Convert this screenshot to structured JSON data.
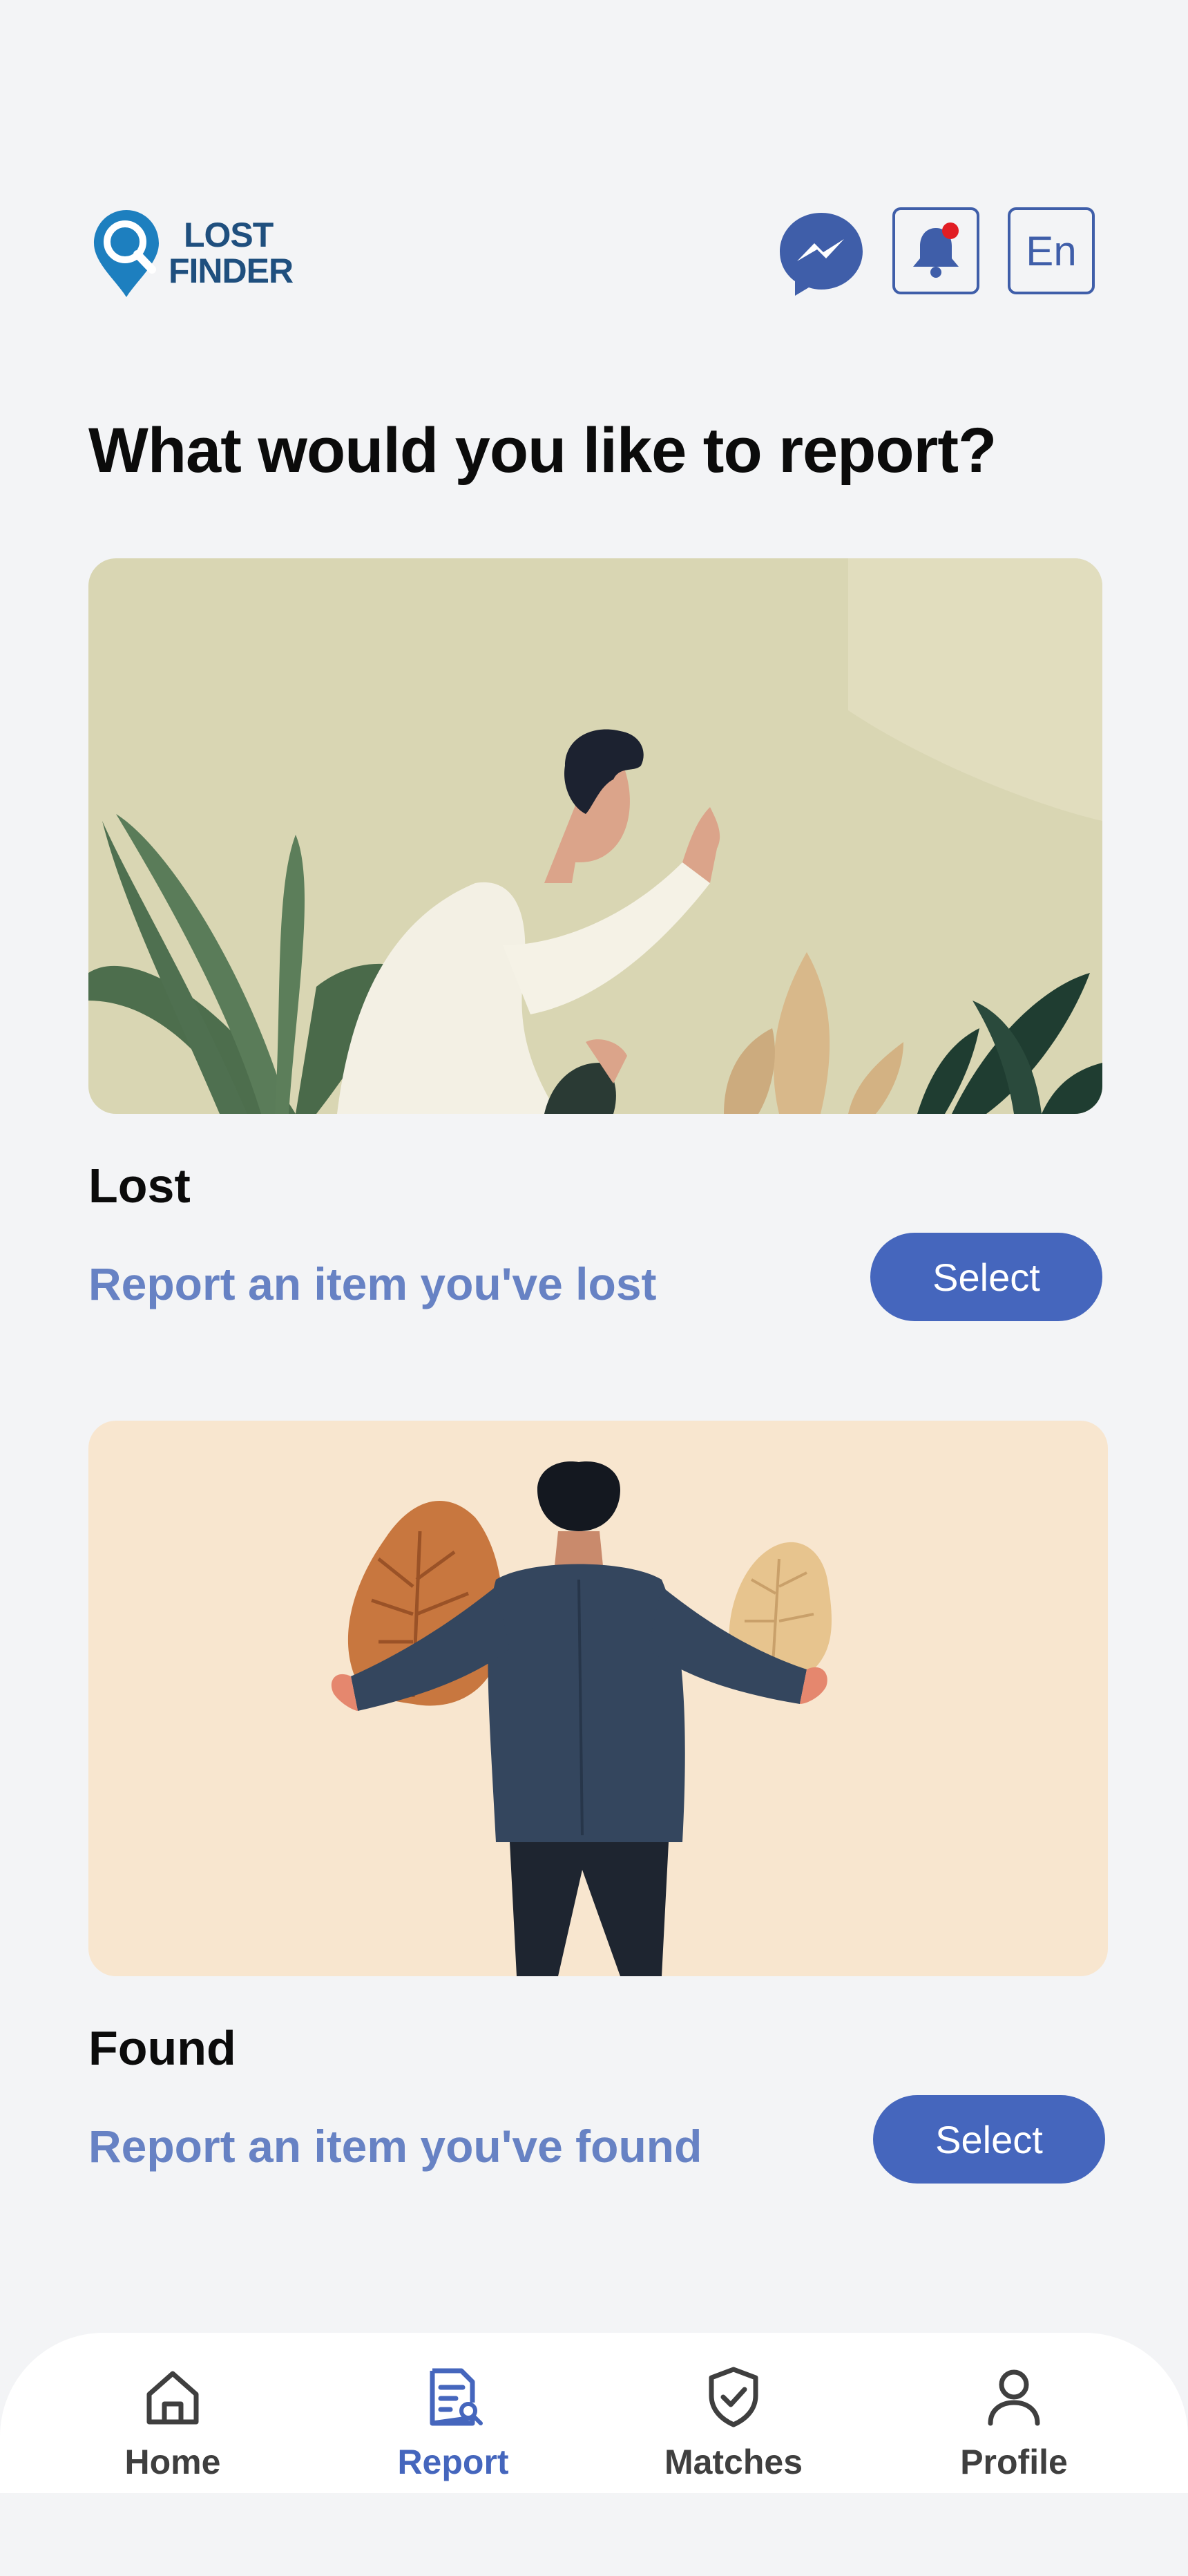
{
  "header": {
    "logo_line1": "LOST",
    "logo_line2": "FINDER",
    "language": "En",
    "icons": [
      "location-search-icon",
      "messenger-icon",
      "bell-icon"
    ],
    "notification_dot_color": "#e11d24"
  },
  "page": {
    "title": "What would you like to report?"
  },
  "cards": [
    {
      "title": "Lost",
      "subtitle": "Report an item you've lost",
      "button": "Select"
    },
    {
      "title": "Found",
      "subtitle": "Report an item you've found",
      "button": "Select"
    }
  ],
  "nav": {
    "items": [
      {
        "label": "Home",
        "icon": "home-icon",
        "active": false
      },
      {
        "label": "Report",
        "icon": "report-icon",
        "active": true
      },
      {
        "label": "Matches",
        "icon": "shield-check-icon",
        "active": false
      },
      {
        "label": "Profile",
        "icon": "person-icon",
        "active": false
      }
    ]
  },
  "colors": {
    "accent": "#4566bd",
    "subtitle": "#6782c4",
    "logo": "#1f4f7e",
    "background": "#f3f4f6"
  }
}
